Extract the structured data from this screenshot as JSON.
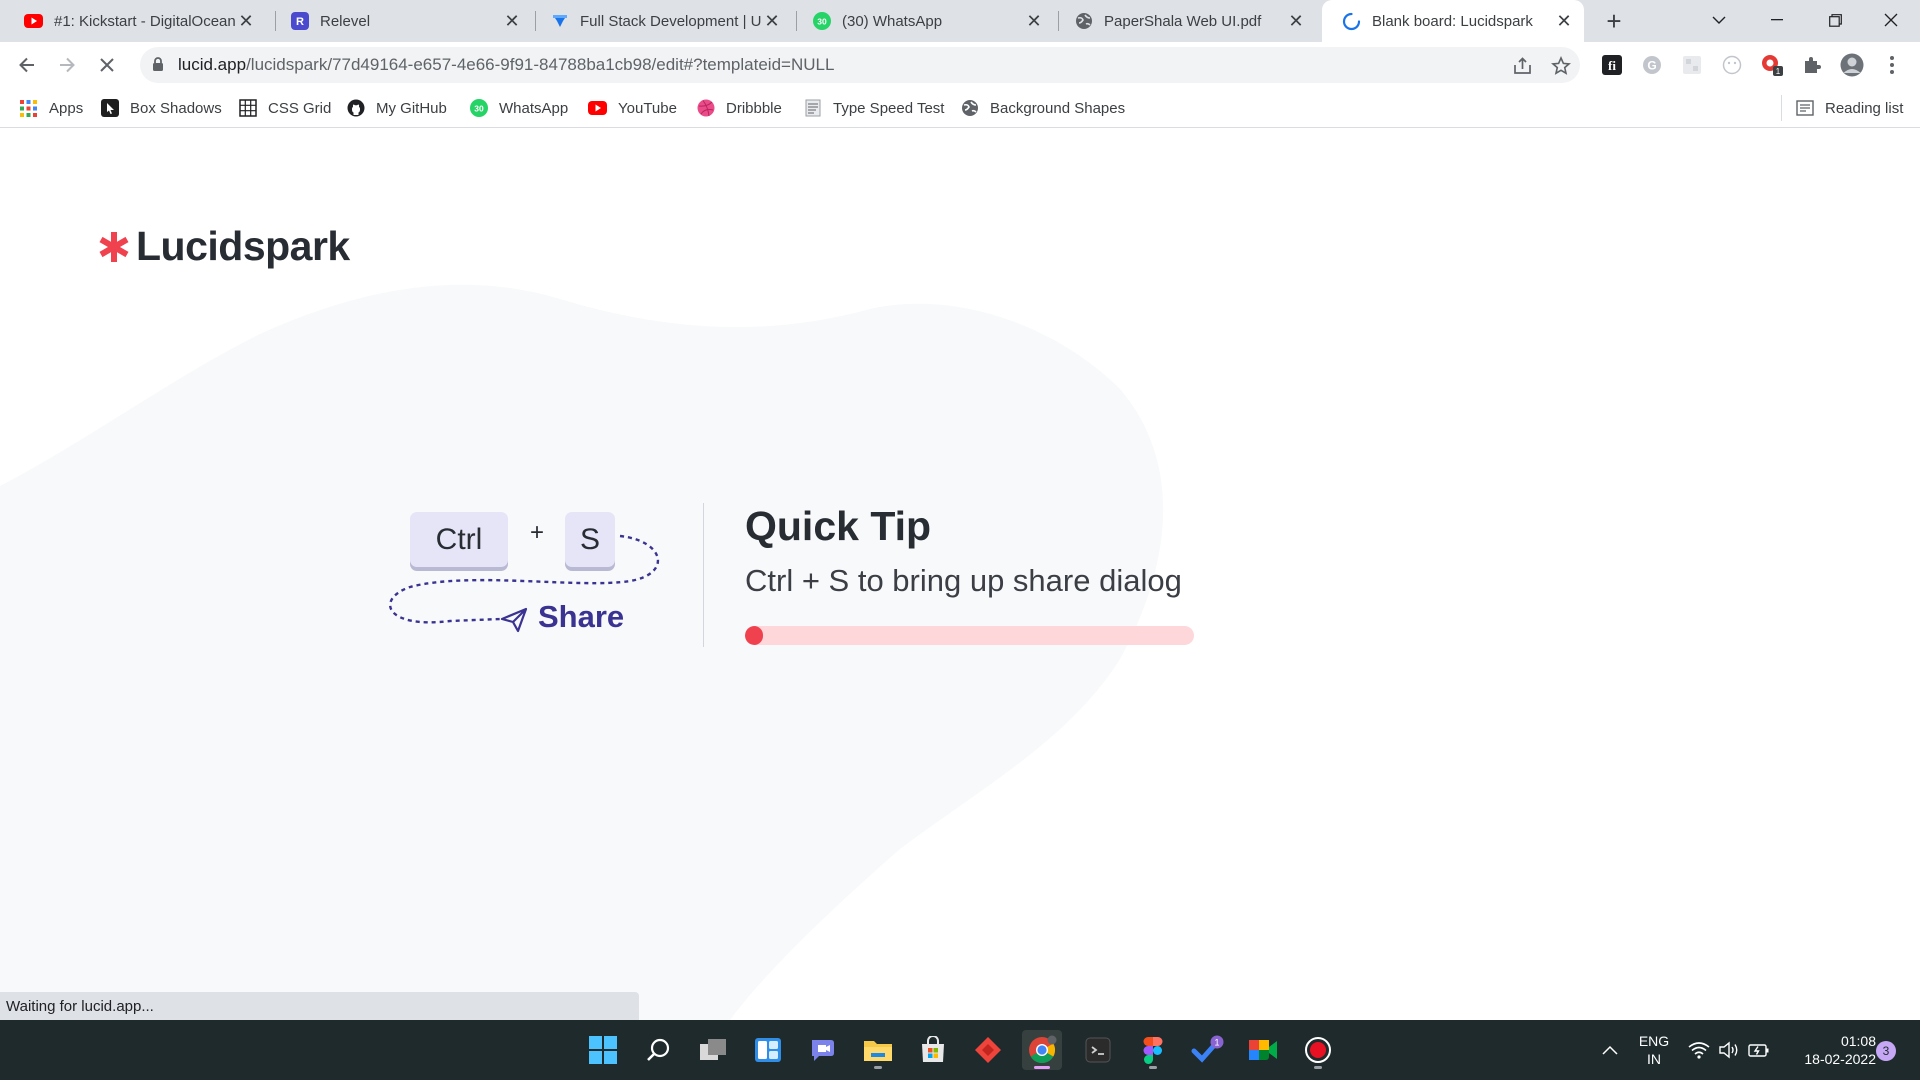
{
  "tabs": [
    {
      "title": "#1: Kickstart - DigitalOcean",
      "icon": "youtube-icon",
      "active": false
    },
    {
      "title": "Relevel",
      "icon": "relevel-icon",
      "active": false
    },
    {
      "title": "Full Stack Development | Ur",
      "icon": "course-icon",
      "active": false
    },
    {
      "title": "(30) WhatsApp",
      "icon": "whatsapp-icon",
      "active": false
    },
    {
      "title": "PaperShala Web UI.pdf",
      "icon": "globe-icon",
      "active": false
    },
    {
      "title": "Blank board: Lucidspark",
      "icon": "loading-icon",
      "active": true
    }
  ],
  "address": {
    "host": "lucid.app",
    "path": "/lucidspark/77d49164-e657-4e66-9f91-84788ba1cb98/edit#?templateid=NULL"
  },
  "bookmarks": [
    {
      "label": "Apps",
      "icon": "apps-grid-icon"
    },
    {
      "label": "Box Shadows",
      "icon": "box-shadows-icon"
    },
    {
      "label": "CSS Grid",
      "icon": "grid-icon"
    },
    {
      "label": "My GitHub",
      "icon": "github-icon"
    },
    {
      "label": "WhatsApp",
      "icon": "whatsapp-icon"
    },
    {
      "label": "YouTube",
      "icon": "youtube-icon"
    },
    {
      "label": "Dribbble",
      "icon": "dribbble-icon"
    },
    {
      "label": "Type Speed Test",
      "icon": "page-icon"
    },
    {
      "label": "Background Shapes",
      "icon": "globe-icon"
    }
  ],
  "reading_list": "Reading list",
  "whatsapp_badge": "30",
  "extension_badge": "1",
  "page": {
    "logo_text": "Lucidspark",
    "keys": {
      "ctrl": "Ctrl",
      "plus": "+",
      "s": "S"
    },
    "share_label": "Share",
    "tip_title": "Quick Tip",
    "tip_text": "Ctrl + S to bring up share dialog",
    "progress": 0.04
  },
  "status_text": "Waiting for lucid.app...",
  "taskbar": {
    "lang_top": "ENG",
    "lang_bottom": "IN",
    "time": "01:08",
    "date": "18-02-2022",
    "notification_count": "3",
    "todo_badge": "1"
  },
  "colors": {
    "brand_red": "#f0414f",
    "share_indigo": "#3a3392",
    "taskbar_bg": "#1e2a2b"
  }
}
